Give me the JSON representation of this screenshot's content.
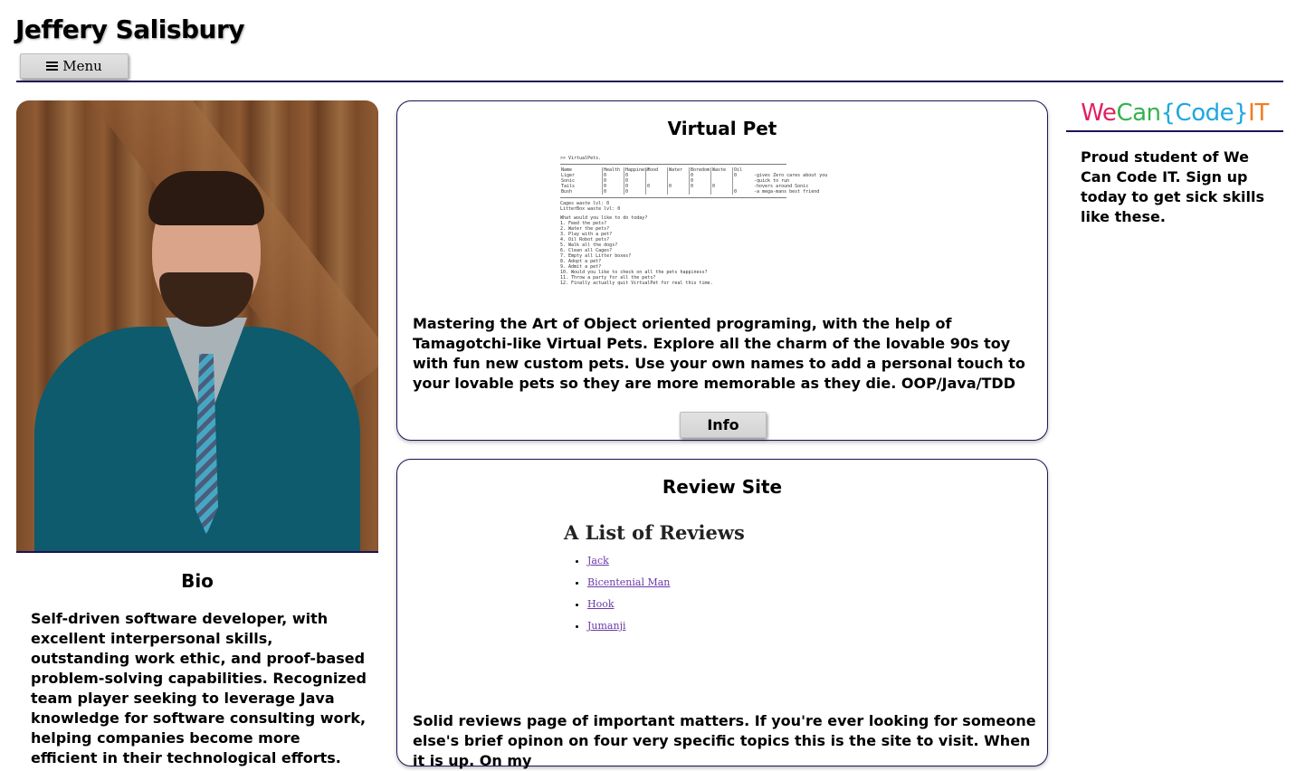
{
  "header": {
    "title": "Jeffery Salisbury",
    "menu_label": "Menu"
  },
  "bio": {
    "heading": "Bio",
    "text": "Self-driven software developer, with excellent interpersonal skills, outstanding work ethic, and proof-based problem-solving capabilities. Recognized team player seeking to leverage Java knowledge for software consulting work, helping companies become more efficient in their technological efforts."
  },
  "projects": [
    {
      "title": "Virtual Pet",
      "description": "Mastering the Art of Object oriented programing, with the help of Tamagotchi-like Virtual Pets. Explore all the charm of the lovable 90s toy with fun new custom pets. Use your own names to add a personal touch to your lovable pets so they are more memorable as they die. OOP/Java/TDD",
      "button_label": "Info",
      "screenshot": {
        "prompt": ">> VirtualPets.",
        "columns": [
          "Name",
          "Health",
          "Happiness",
          "Food",
          "Water",
          "Boredom",
          "Waste",
          "Oil"
        ],
        "rows": [
          [
            "Liger",
            "0",
            "0",
            "",
            "",
            "0",
            "",
            "0",
            "-gives Zero cares about you"
          ],
          [
            "Sonic",
            "0",
            "0",
            "",
            "",
            "0",
            "",
            "",
            "-quick to run"
          ],
          [
            "Tails",
            "0",
            "0",
            "0",
            "0",
            "0",
            "0",
            "",
            "-hovers around Sonic"
          ],
          [
            "Bush",
            "0",
            "0",
            "",
            "",
            "",
            "",
            "0",
            "-a mega-mans best friend"
          ]
        ],
        "waste_lines": [
          "Cages waste lvl: 0",
          "LitterBox waste lvl: 0"
        ],
        "menu_prompt": "What would you like to do today?",
        "menu_options": [
          "1. Feed the pets?",
          "2. Water the pets?",
          "3. Play with a pet?",
          "4. Oil Robot pets?",
          "5. Walk all the dogs?",
          "6. Clean all Cages?",
          "7. Empty all Litter boxes?",
          "8. Adopt a pet?",
          "9. Admit a pet?",
          "10. Would you like to check on all the pets happiness?",
          "11. Throw a party for all the pets?",
          "12. Finally actually quit VirtualPet for real this time."
        ]
      }
    },
    {
      "title": "Review Site",
      "description": "Solid reviews page of important matters. If you're ever looking for someone else's brief opinon on four very specific topics this is the site to visit. When it is up. On my",
      "screenshot": {
        "heading": "A List of Reviews",
        "links": [
          "Jack",
          "Bicentenial Man",
          "Hook",
          "Jumanji"
        ]
      }
    }
  ],
  "sidebar": {
    "logo": {
      "we": "We",
      "can": "Can",
      "code": "{Code}",
      "it": "IT"
    },
    "text": "Proud student of We Can Code IT. Sign up today to get sick skills like these.",
    "colors": {
      "we": "#e0215f",
      "can": "#34b24f",
      "code": "#1ea7e0",
      "it": "#f47b20"
    }
  }
}
